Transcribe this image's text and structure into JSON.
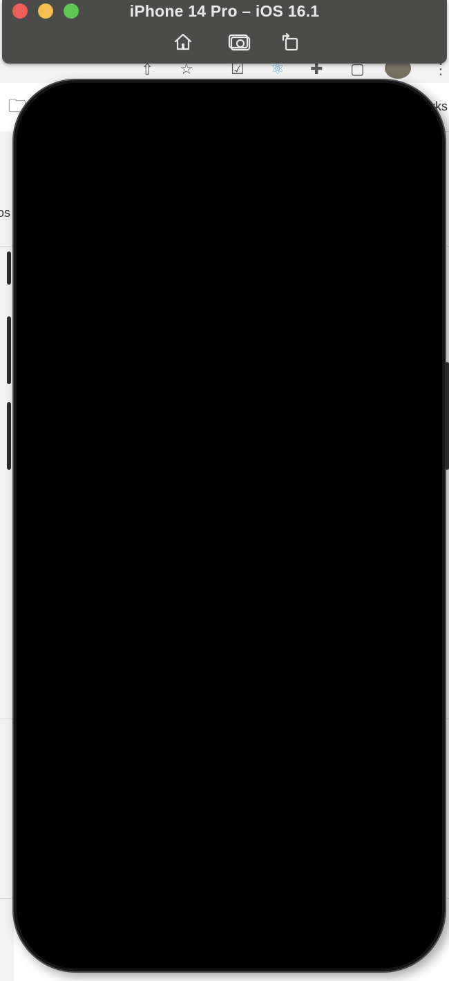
{
  "window": {
    "title": "iPhone 14 Pro – iOS 16.1"
  },
  "toolbar": {
    "home_icon": "home-icon",
    "screenshot_icon": "camera-icon",
    "rotate_icon": "rotate-icon"
  },
  "background": {
    "bookmark_partial_text": "rks",
    "left_partial_text": "os"
  },
  "colors": {
    "titlebar": "#4b4c49",
    "close": "#ee5f5a",
    "minimize": "#f5be4f",
    "zoom": "#5fc653",
    "screen": "#000000"
  }
}
